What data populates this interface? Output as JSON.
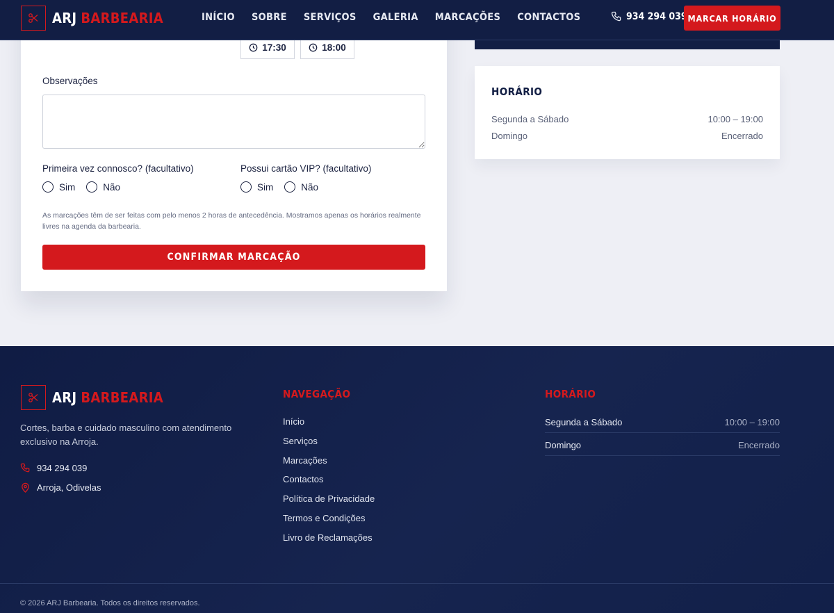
{
  "header": {
    "logo": {
      "brand_a": "ARJ",
      "brand_b": "BARBEARIA",
      "icon": "scissors-icon"
    },
    "nav": [
      "INÍCIO",
      "SOBRE",
      "SERVIÇOS",
      "GALERIA",
      "MARCAÇÕES",
      "CONTACTOS"
    ],
    "phone": "934 294 039",
    "cta": "MARCAR HORÁRIO"
  },
  "form": {
    "time_slots": [
      "17:30",
      "18:00"
    ],
    "observations_label": "Observações",
    "observations_value": "",
    "first_time": {
      "label": "Primeira vez connosco? (facultativo)",
      "options": [
        "Sim",
        "Não"
      ]
    },
    "vip_card": {
      "label": "Possui cartão VIP? (facultativo)",
      "options": [
        "Sim",
        "Não"
      ]
    },
    "notice": "As marcações têm de ser feitas com pelo menos 2 horas de antecedência. Mostramos apenas os horários realmente livres na agenda da barbearia.",
    "confirm": "CONFIRMAR MARCAÇÃO"
  },
  "hours_card": {
    "title": "HORÁRIO",
    "rows": [
      {
        "day": "Segunda a Sábado",
        "time": "10:00 – 19:00"
      },
      {
        "day": "Domingo",
        "time": "Encerrado"
      }
    ]
  },
  "footer": {
    "logo": {
      "brand_a": "ARJ",
      "brand_b": "BARBEARIA"
    },
    "description": "Cortes, barba e cuidado masculino com atendimento exclusivo na Arroja.",
    "phone": "934 294 039",
    "location": "Arroja, Odivelas",
    "nav_title": "NAVEGAÇÃO",
    "nav_links": [
      "Início",
      "Serviços",
      "Marcações",
      "Contactos",
      "Política de Privacidade",
      "Termos e Condições",
      "Livro de Reclamações"
    ],
    "hours_title": "HORÁRIO",
    "hours": [
      {
        "day": "Segunda a Sábado",
        "time": "10:00 – 19:00"
      },
      {
        "day": "Domingo",
        "time": "Encerrado"
      }
    ],
    "copyright": "© 2026 ARJ Barbearia. Todos os direitos reservados."
  },
  "colors": {
    "navy": "#121e44",
    "accent": "#d4191d",
    "page_bg": "#eeeff5"
  }
}
